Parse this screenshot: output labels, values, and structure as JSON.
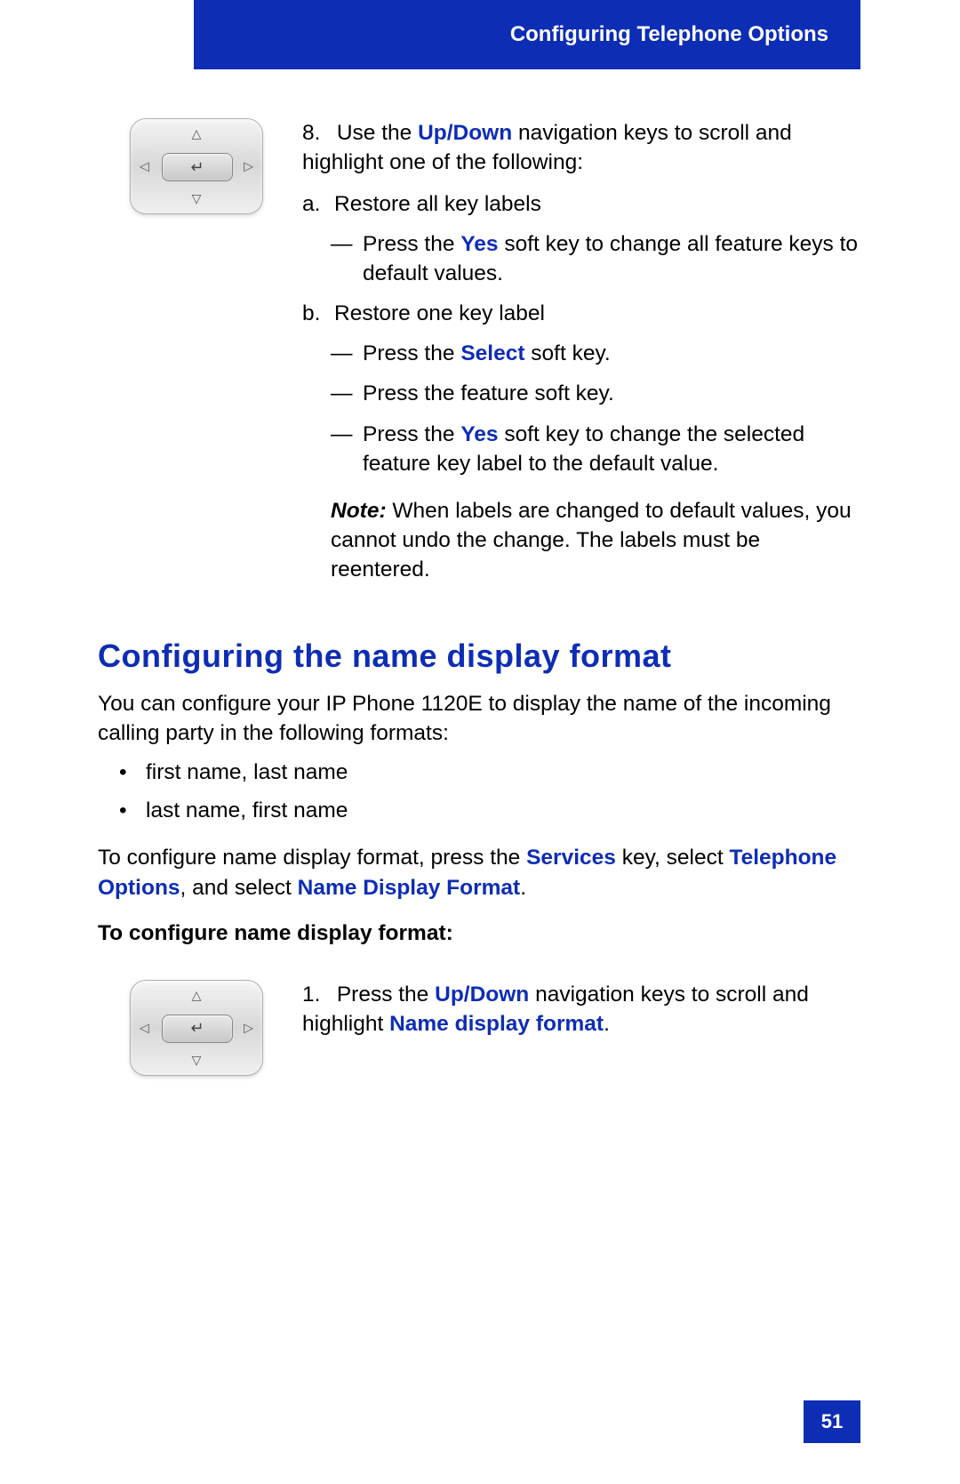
{
  "header": {
    "title": "Configuring Telephone Options"
  },
  "step8": {
    "number": "8.",
    "intro_pre": "Use the ",
    "updown": "Up/Down",
    "intro_post": " navigation keys to scroll and highlight one of the following:",
    "a": {
      "label": "a.",
      "text": "Restore all key labels"
    },
    "a_dash1": {
      "dash": "—",
      "pre": "Press the ",
      "yes": "Yes",
      "post": " soft key to change all feature keys to default values."
    },
    "b": {
      "label": "b.",
      "text": "Restore one key label"
    },
    "b_dash1": {
      "dash": "—",
      "pre": "Press the ",
      "select": "Select",
      "post": " soft key."
    },
    "b_dash2": {
      "dash": "—",
      "text": "Press the feature soft key."
    },
    "b_dash3": {
      "dash": "—",
      "pre": "Press the ",
      "yes": "Yes",
      "post": " soft key to change the selected feature key label to the default value."
    },
    "note": {
      "label": "Note:",
      "text": " When labels are changed to default values, you cannot undo the change. The labels must be reentered."
    }
  },
  "section": {
    "heading": "Configuring the name display format",
    "intro": "You can configure your IP Phone 1120E to display the name of the incoming calling party in the following formats:",
    "bullets": [
      "first name, last name",
      "last name, first name"
    ],
    "configInstr": {
      "pre": "To configure name display format, press the ",
      "services": "Services",
      "mid1": " key, select ",
      "telOpts": "Telephone Options",
      "mid2": ", and select ",
      "ndf": "Name Display Format",
      "post": "."
    },
    "subhead": "To configure name display format:"
  },
  "step1": {
    "number": "1.",
    "pre": "Press the ",
    "updown": "Up/Down",
    "mid": " navigation keys to scroll and highlight ",
    "ndf": "Name display format",
    "post": "."
  },
  "pageNum": "51"
}
